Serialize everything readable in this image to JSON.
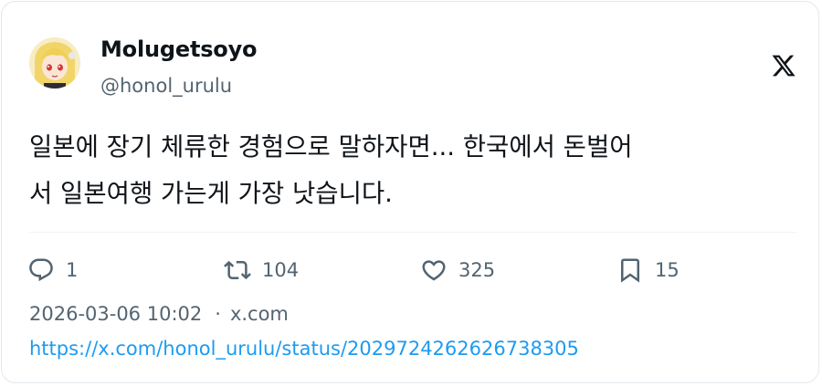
{
  "author": {
    "display_name": "Molugetsoyo",
    "handle": "@honol_urulu"
  },
  "tweet": {
    "text_line1": "일본에 장기 체류한 경험으로 말하자면... 한국에서 돈벌어",
    "text_line2": "서 일본여행 가는게 가장 낫습니다."
  },
  "actions": {
    "replies": "1",
    "retweets": "104",
    "likes": "325",
    "bookmarks": "15"
  },
  "meta": {
    "timestamp": "2026-03-06 10:02",
    "separator": "·",
    "source": "x.com",
    "url": "https://x.com/honol_urulu/status/2029724262626738305"
  },
  "icons": {
    "brand": "x-logo-icon",
    "reply": "reply-icon",
    "retweet": "retweet-icon",
    "like": "heart-icon",
    "bookmark": "bookmark-icon"
  },
  "colors": {
    "text": "#0f1419",
    "secondary": "#536471",
    "link": "#1d9bf0",
    "border": "#e1e8ed"
  }
}
